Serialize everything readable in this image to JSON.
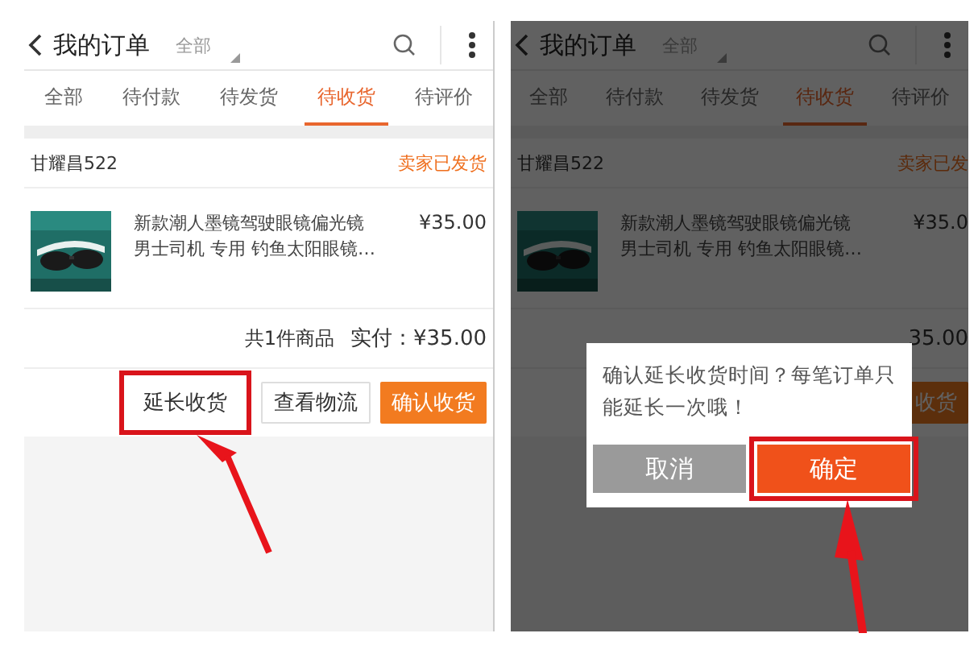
{
  "screens": [
    {
      "kind": "normal",
      "header": {
        "title": "我的订单",
        "filter": "全部"
      },
      "tabs": [
        {
          "label": "全部",
          "selected": false
        },
        {
          "label": "待付款",
          "selected": false
        },
        {
          "label": "待发货",
          "selected": false
        },
        {
          "label": "待收货",
          "selected": true
        },
        {
          "label": "待评价",
          "selected": false
        }
      ],
      "order": {
        "shop": "甘耀昌522",
        "status": "卖家已发货",
        "product": {
          "kind": "picture",
          "title": "新款潮人墨镜驾驶眼镜偏光镜男士司机 专用 钓鱼太阳眼镜…",
          "price": "¥35.00"
        },
        "summary": [
          "共1件商品",
          "实付：¥35.00"
        ],
        "buttons": [
          {
            "label": "延长收货",
            "kind": "outline",
            "highlighted": true
          },
          {
            "label": "查看物流",
            "kind": "outline",
            "highlighted": false
          },
          {
            "label": "确认收货",
            "kind": "primary",
            "highlighted": false
          }
        ]
      }
    },
    {
      "kind": "dimmed",
      "header": {
        "title": "我的订单",
        "filter": "全部"
      },
      "tabs": [
        {
          "label": "全部",
          "selected": false
        },
        {
          "label": "待付款",
          "selected": false
        },
        {
          "label": "待发货",
          "selected": false
        },
        {
          "label": "待收货",
          "selected": true
        },
        {
          "label": "待评价",
          "selected": false
        }
      ],
      "order": {
        "shop": "甘耀昌522",
        "status": "卖家已发",
        "product": {
          "kind": "picture",
          "title": "新款潮人墨镜驾驶眼镜偏光镜男士司机 专用 钓鱼太阳眼镜…",
          "price": "¥35.0"
        },
        "summary": [
          "35.00"
        ],
        "buttons": [
          {
            "label": "收货",
            "kind": "primary",
            "highlighted": false
          }
        ]
      },
      "dialog": {
        "message": "确认延长收货时间？每笔订单只能延长一次哦！",
        "buttons": [
          {
            "label": "取消",
            "kind": "cancel",
            "highlighted": false
          },
          {
            "label": "确定",
            "kind": "confirm",
            "highlighted": true
          }
        ]
      }
    }
  ]
}
